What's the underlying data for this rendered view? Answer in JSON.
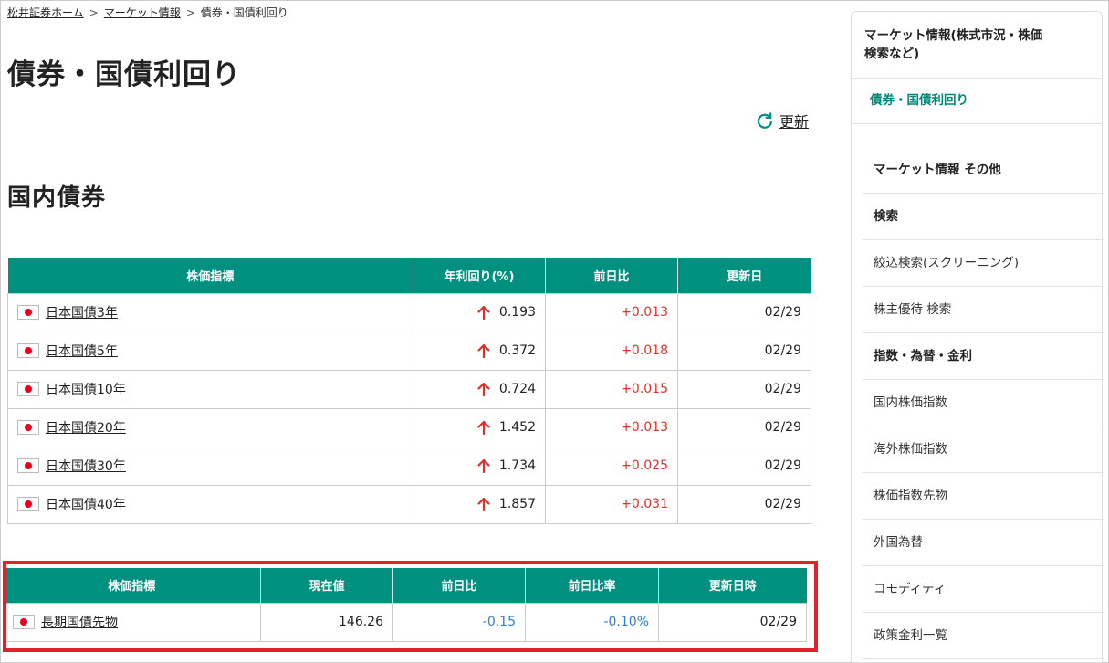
{
  "breadcrumb": {
    "home": "松井証券ホーム",
    "market": "マーケット情報",
    "current": "債券・国債利回り",
    "sep": ">"
  },
  "page_title": "債券・国債利回り",
  "refresh_label": "更新",
  "section_title": "国内債券",
  "bonds_table": {
    "headers": [
      "株価指標",
      "年利回り(%)",
      "前日比",
      "更新日"
    ],
    "rows": [
      {
        "name": "日本国債3年",
        "yield": "0.193",
        "change": "+0.013",
        "date": "02/29",
        "trend": "up"
      },
      {
        "name": "日本国債5年",
        "yield": "0.372",
        "change": "+0.018",
        "date": "02/29",
        "trend": "up"
      },
      {
        "name": "日本国債10年",
        "yield": "0.724",
        "change": "+0.015",
        "date": "02/29",
        "trend": "up"
      },
      {
        "name": "日本国債20年",
        "yield": "1.452",
        "change": "+0.013",
        "date": "02/29",
        "trend": "up"
      },
      {
        "name": "日本国債30年",
        "yield": "1.734",
        "change": "+0.025",
        "date": "02/29",
        "trend": "up"
      },
      {
        "name": "日本国債40年",
        "yield": "1.857",
        "change": "+0.031",
        "date": "02/29",
        "trend": "up"
      }
    ]
  },
  "futures_table": {
    "headers": [
      "株価指標",
      "現在値",
      "前日比",
      "前日比率",
      "更新日時"
    ],
    "rows": [
      {
        "name": "長期国債先物",
        "price": "146.26",
        "change": "-0.15",
        "change_rate": "-0.10%",
        "date": "02/29"
      }
    ]
  },
  "sidebar": {
    "header": "マーケット情報(株式市況・株価検索など)",
    "header_line1": "マーケット情報(株式市況・株価",
    "header_line2": "検索など)",
    "active": "債券・国債利回り",
    "items": [
      {
        "label": "マーケット情報 その他",
        "kind": "hdr"
      },
      {
        "label": "検索",
        "kind": "hdr"
      },
      {
        "label": "絞込検索(スクリーニング)",
        "kind": "link"
      },
      {
        "label": "株主優待 検索",
        "kind": "link"
      },
      {
        "label": "指数・為替・金利",
        "kind": "hdr"
      },
      {
        "label": "国内株価指数",
        "kind": "link"
      },
      {
        "label": "海外株価指数",
        "kind": "link"
      },
      {
        "label": "株価指数先物",
        "kind": "link"
      },
      {
        "label": "外国為替",
        "kind": "link"
      },
      {
        "label": "コモディティ",
        "kind": "link"
      },
      {
        "label": "政策金利一覧",
        "kind": "link"
      }
    ]
  },
  "colors": {
    "header_green": "#009080",
    "up_red": "#e0302a",
    "down_blue": "#2f7fd9",
    "highlight_red": "#e4202a",
    "active_green": "#00897b"
  }
}
